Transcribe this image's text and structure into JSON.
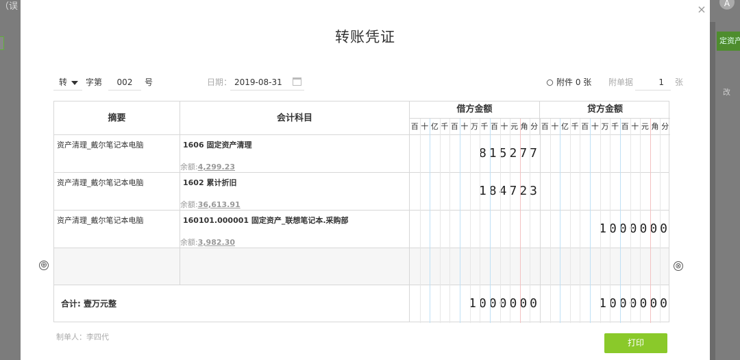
{
  "backdrop": {
    "left_text": "（误",
    "right_avatar": "A",
    "right_button": "定资产",
    "right_text": "改"
  },
  "dialog": {
    "title": "转账凭证",
    "close_glyph": "×"
  },
  "header": {
    "voucher_type": "转",
    "zi_label": "字第",
    "voucher_number": "002",
    "hao_label": "号",
    "date_label": "日期：",
    "date_value": "2019-08-31",
    "attachment_link": "附件 0 张",
    "attach_doc_label": "附单据",
    "attach_doc_count": "1",
    "zhang_label": "张"
  },
  "table": {
    "col_summary": "摘要",
    "col_account": "会计科目",
    "col_debit": "借方金额",
    "col_credit": "贷方金额",
    "units": [
      "百",
      "十",
      "亿",
      "千",
      "百",
      "十",
      "万",
      "千",
      "百",
      "十",
      "元",
      "角",
      "分"
    ],
    "rows": [
      {
        "summary": "资产清理_戴尔笔记本电脑",
        "account": "1606 固定资产清理",
        "balance_label": "余额:",
        "balance": "4,299.23",
        "debit": "815277",
        "credit": ""
      },
      {
        "summary": "资产清理_戴尔笔记本电脑",
        "account": "1602 累计折旧",
        "balance_label": "余额:",
        "balance": "36,613.91",
        "debit": "184723",
        "credit": ""
      },
      {
        "summary": "资产清理_戴尔笔记本电脑",
        "account": "160101.000001 固定资产_联想笔记本.采购部",
        "balance_label": "余额:",
        "balance": "3,982.30",
        "debit": "",
        "credit": "1000000"
      }
    ],
    "total_label": "合计:  壹万元整",
    "total_debit": "1000000",
    "total_credit": "1000000"
  },
  "footer": {
    "maker": "制单人：李四代",
    "print_button": "打印"
  },
  "icons": {
    "add_row": "⊕",
    "delete_row": "⊗"
  }
}
